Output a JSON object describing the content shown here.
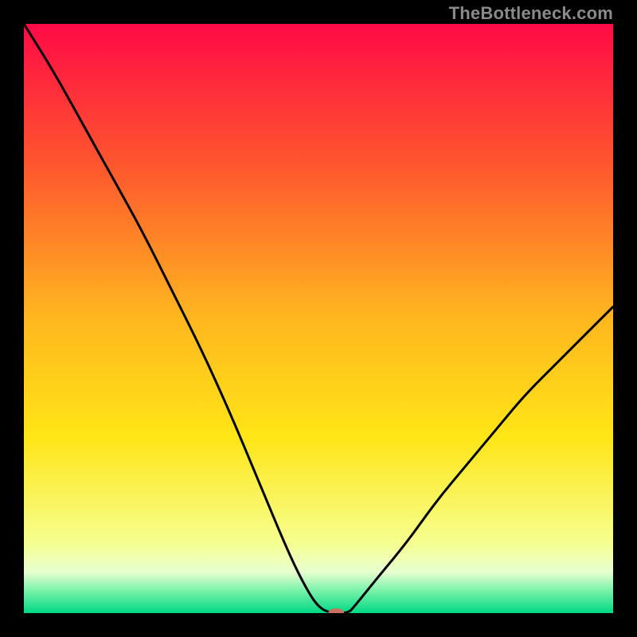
{
  "watermark": "TheBottleneck.com",
  "chart_data": {
    "type": "line",
    "title": "",
    "xlabel": "",
    "ylabel": "",
    "xlim": [
      0,
      100
    ],
    "ylim": [
      0,
      100
    ],
    "legend": false,
    "grid": false,
    "background_gradient": {
      "stops": [
        {
          "pos": 0.0,
          "color": "#ff0a46"
        },
        {
          "pos": 0.25,
          "color": "#ff5a2d"
        },
        {
          "pos": 0.5,
          "color": "#ffb71f"
        },
        {
          "pos": 0.7,
          "color": "#ffe516"
        },
        {
          "pos": 0.88,
          "color": "#f6ff8f"
        },
        {
          "pos": 0.93,
          "color": "#e8ffcf"
        },
        {
          "pos": 0.965,
          "color": "#6ff0a8"
        },
        {
          "pos": 1.0,
          "color": "#00d883"
        }
      ]
    },
    "series": [
      {
        "name": "bottleneck-curve",
        "stroke": "#000000",
        "stroke_width": 3,
        "x": [
          0,
          5,
          10,
          15,
          20,
          25,
          30,
          35,
          40,
          45,
          48,
          50,
          52,
          55,
          56,
          60,
          65,
          70,
          75,
          80,
          85,
          90,
          95,
          100
        ],
        "y": [
          100,
          92,
          83,
          74,
          65,
          55,
          45,
          34,
          22,
          10,
          4,
          1,
          0,
          0,
          1,
          6,
          12,
          19,
          25,
          31,
          37,
          42,
          47,
          52
        ]
      }
    ],
    "marker": {
      "name": "min-marker",
      "x": 53,
      "y": 0,
      "color": "#cc6f62",
      "rx": 10,
      "ry": 6
    }
  }
}
